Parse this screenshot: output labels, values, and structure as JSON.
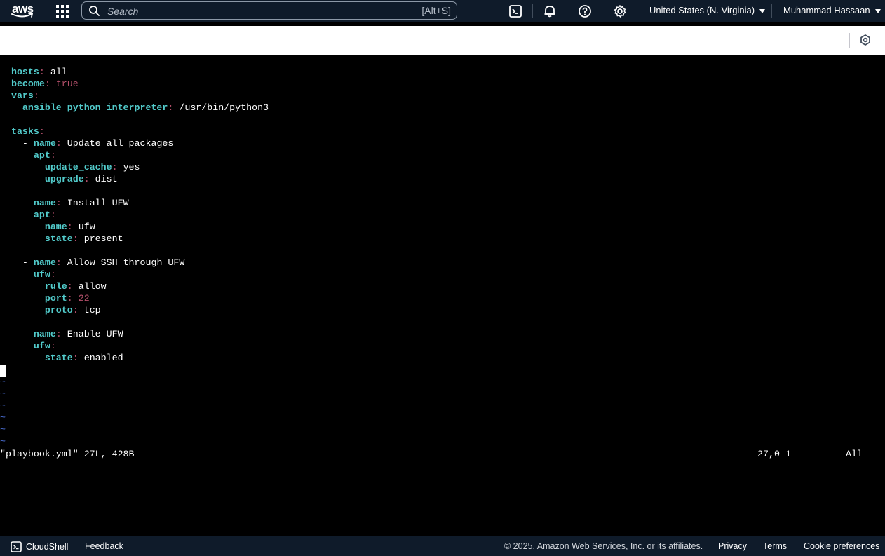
{
  "header": {
    "logo_text": "aws",
    "search_placeholder": "Search",
    "search_shortcut": "[Alt+S]",
    "region": "United States (N. Virginia)",
    "user": "Muhammad Hassaan",
    "icons": [
      "apps-grid-icon",
      "cloudshell-icon",
      "bell-icon",
      "help-icon",
      "gear-icon"
    ]
  },
  "toolbar": {
    "icon": "shield-icon"
  },
  "terminal": {
    "lines": [
      [
        {
          "t": "---",
          "c": "p"
        }
      ],
      [
        {
          "t": "- "
        },
        {
          "t": "hosts",
          "c": "k"
        },
        {
          "t": ":",
          "c": "p"
        },
        {
          "t": " all"
        }
      ],
      [
        {
          "t": "  "
        },
        {
          "t": "become",
          "c": "k"
        },
        {
          "t": ":",
          "c": "p"
        },
        {
          "t": " "
        },
        {
          "t": "true",
          "c": "p"
        }
      ],
      [
        {
          "t": "  "
        },
        {
          "t": "vars",
          "c": "k"
        },
        {
          "t": ":",
          "c": "p"
        }
      ],
      [
        {
          "t": "    "
        },
        {
          "t": "ansible_python_interpreter",
          "c": "k"
        },
        {
          "t": ":",
          "c": "p"
        },
        {
          "t": " /usr/bin/python3"
        }
      ],
      [],
      [
        {
          "t": "  "
        },
        {
          "t": "tasks",
          "c": "k"
        },
        {
          "t": ":",
          "c": "p"
        }
      ],
      [
        {
          "t": "    - "
        },
        {
          "t": "name",
          "c": "k"
        },
        {
          "t": ":",
          "c": "p"
        },
        {
          "t": " Update all packages"
        }
      ],
      [
        {
          "t": "      "
        },
        {
          "t": "apt",
          "c": "k"
        },
        {
          "t": ":",
          "c": "p"
        }
      ],
      [
        {
          "t": "        "
        },
        {
          "t": "update_cache",
          "c": "k"
        },
        {
          "t": ":",
          "c": "p"
        },
        {
          "t": " yes"
        }
      ],
      [
        {
          "t": "        "
        },
        {
          "t": "upgrade",
          "c": "k"
        },
        {
          "t": ":",
          "c": "p"
        },
        {
          "t": " dist"
        }
      ],
      [],
      [
        {
          "t": "    - "
        },
        {
          "t": "name",
          "c": "k"
        },
        {
          "t": ":",
          "c": "p"
        },
        {
          "t": " Install UFW"
        }
      ],
      [
        {
          "t": "      "
        },
        {
          "t": "apt",
          "c": "k"
        },
        {
          "t": ":",
          "c": "p"
        }
      ],
      [
        {
          "t": "        "
        },
        {
          "t": "name",
          "c": "k"
        },
        {
          "t": ":",
          "c": "p"
        },
        {
          "t": " ufw"
        }
      ],
      [
        {
          "t": "        "
        },
        {
          "t": "state",
          "c": "k"
        },
        {
          "t": ":",
          "c": "p"
        },
        {
          "t": " present"
        }
      ],
      [],
      [
        {
          "t": "    - "
        },
        {
          "t": "name",
          "c": "k"
        },
        {
          "t": ":",
          "c": "p"
        },
        {
          "t": " Allow SSH through UFW"
        }
      ],
      [
        {
          "t": "      "
        },
        {
          "t": "ufw",
          "c": "k"
        },
        {
          "t": ":",
          "c": "p"
        }
      ],
      [
        {
          "t": "        "
        },
        {
          "t": "rule",
          "c": "k"
        },
        {
          "t": ":",
          "c": "p"
        },
        {
          "t": " allow"
        }
      ],
      [
        {
          "t": "        "
        },
        {
          "t": "port",
          "c": "k"
        },
        {
          "t": ":",
          "c": "p"
        },
        {
          "t": " "
        },
        {
          "t": "22",
          "c": "p"
        }
      ],
      [
        {
          "t": "        "
        },
        {
          "t": "proto",
          "c": "k"
        },
        {
          "t": ":",
          "c": "p"
        },
        {
          "t": " tcp"
        }
      ],
      [],
      [
        {
          "t": "    - "
        },
        {
          "t": "name",
          "c": "k"
        },
        {
          "t": ":",
          "c": "p"
        },
        {
          "t": " Enable UFW"
        }
      ],
      [
        {
          "t": "      "
        },
        {
          "t": "ufw",
          "c": "k"
        },
        {
          "t": ":",
          "c": "p"
        }
      ],
      [
        {
          "t": "        "
        },
        {
          "t": "state",
          "c": "k"
        },
        {
          "t": ":",
          "c": "p"
        },
        {
          "t": " enabled"
        }
      ]
    ],
    "tilde_lines": [
      "~",
      "~",
      "~",
      "~",
      "~",
      "~"
    ],
    "status_left": "\"playbook.yml\" 27L, 428B",
    "status_position": "27,0-1",
    "status_right": "All"
  },
  "footer": {
    "cloudshell_label": "CloudShell",
    "feedback_label": "Feedback",
    "copyright": "© 2025, Amazon Web Services, Inc. or its affiliates.",
    "privacy_label": "Privacy",
    "terms_label": "Terms",
    "cookie_label": "Cookie preferences"
  },
  "colors": {
    "nav_bg": "#0f1b2a",
    "yaml_key": "#52cbcb",
    "yaml_punct": "#b5506b",
    "tilde": "#4b6fd6"
  }
}
